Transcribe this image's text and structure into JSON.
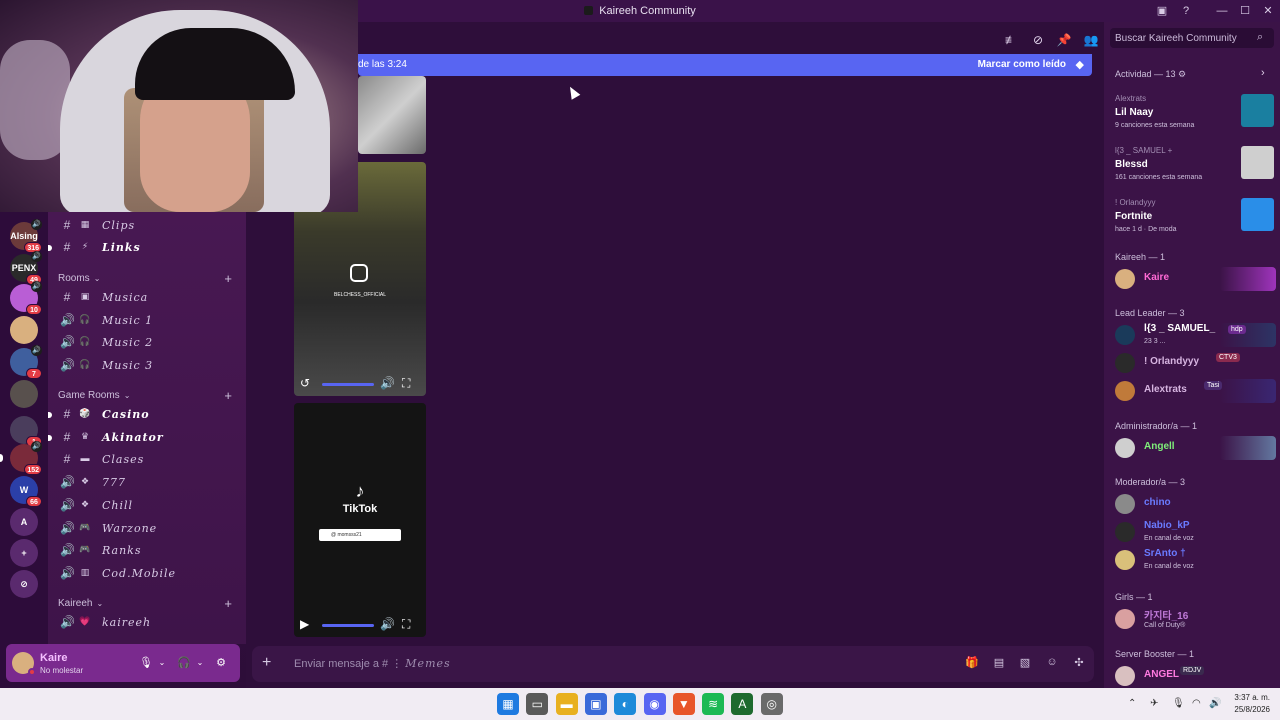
{
  "window": {
    "title": "Kaireeh Community"
  },
  "servers": [
    {
      "label": "Alsing",
      "badge": "316",
      "color": "#6b3a3a",
      "speaker": true
    },
    {
      "label": "PENX",
      "badge": "49",
      "color": "#2a2a2a",
      "speaker": true
    },
    {
      "label": "",
      "badge": "10",
      "color": "#b95ed5",
      "speaker": true
    },
    {
      "label": "",
      "badge": "",
      "color": "#d9b07f",
      "speaker": false
    },
    {
      "label": "",
      "badge": "7",
      "color": "#3f5f9e",
      "speaker": true
    },
    {
      "label": "",
      "badge": "",
      "color": "#58504d",
      "speaker": false
    },
    {
      "label": "",
      "badge": "1",
      "color": "#4a3d5c",
      "speaker": false
    },
    {
      "label": "",
      "badge": "152",
      "color": "#7a2a3a",
      "speaker": true
    },
    {
      "label": "W",
      "badge": "66",
      "color": "#2b3fa8",
      "speaker": false
    },
    {
      "label": "A",
      "badge": "",
      "color": "#5a2a6e",
      "speaker": false
    },
    {
      "label": "+",
      "badge": "",
      "color": "#5a2a6e",
      "speaker": false
    },
    {
      "label": "⊘",
      "badge": "",
      "color": "#5a2a6e",
      "speaker": false
    }
  ],
  "channels": {
    "top": [
      {
        "sym": "#",
        "icon": "▦",
        "name": "Clips",
        "bold": false,
        "unread": false
      },
      {
        "sym": "#",
        "icon": "⚡",
        "name": "Links",
        "bold": true,
        "unread": true
      }
    ],
    "rooms_label": "Rooms",
    "rooms": [
      {
        "sym": "#",
        "icon": "▣",
        "name": "Musica"
      },
      {
        "sym": "🔊",
        "icon": "🎧",
        "name": "Music 1"
      },
      {
        "sym": "🔊",
        "icon": "🎧",
        "name": "Music 2"
      },
      {
        "sym": "🔊",
        "icon": "🎧",
        "name": "Music 3"
      }
    ],
    "game_label": "Game Rooms",
    "game": [
      {
        "sym": "#",
        "icon": "🎲",
        "name": "Casino",
        "bold": true,
        "unread": true
      },
      {
        "sym": "#",
        "icon": "♛",
        "name": "Akinator",
        "bold": true,
        "unread": true
      },
      {
        "sym": "#",
        "icon": "▬",
        "name": "Clases",
        "bold": false,
        "unread": false
      },
      {
        "sym": "🔊",
        "icon": "❖",
        "name": "777",
        "bold": false,
        "unread": false
      },
      {
        "sym": "🔊",
        "icon": "❖",
        "name": "Chill",
        "bold": false,
        "unread": false
      },
      {
        "sym": "🔊",
        "icon": "🎮",
        "name": "Warzone",
        "bold": false,
        "unread": false
      },
      {
        "sym": "🔊",
        "icon": "🎮",
        "name": "Ranks",
        "bold": false,
        "unread": false
      },
      {
        "sym": "🔊",
        "icon": "▥",
        "name": "Cod.Mobile",
        "bold": false,
        "unread": false
      }
    ],
    "kaireeh_label": "Kaireeh",
    "kaireeh": [
      {
        "sym": "🔊",
        "icon": "💗",
        "name": "kaireeh"
      }
    ]
  },
  "user": {
    "name": "Kaire",
    "status": "No molestar"
  },
  "chat": {
    "new_messages": "de las 3:24",
    "mark_read": "Marcar como leído",
    "instagram_handle": "BELCHESS_OFFICIAL",
    "tiktok_label": "TikTok",
    "tiktok_handle": "@ momsss21",
    "composer_placeholder": "Enviar mensaje a #",
    "composer_channel": "Memes"
  },
  "members": {
    "search_placeholder": "Buscar Kaireeh Community",
    "activity_header": "Actividad — 13",
    "activity": [
      {
        "by": "Alextrats",
        "title": "Lil Naay",
        "detail": "9 canciones esta semana",
        "thumb": "#1a7fa0"
      },
      {
        "by": "l{3 _ SAMUEL +",
        "title": "Blessd",
        "detail": "161 canciones esta semana",
        "thumb": "#cfcfcf"
      },
      {
        "by": "! Orlandyyy",
        "title": "Fortnite",
        "detail": "hace 1 d   ·  De moda",
        "thumb": "#2a8ee8"
      }
    ],
    "groups": [
      {
        "label": "Kaireeh — 1",
        "members": [
          {
            "name": "Kaire",
            "color": "#ff6ad5",
            "sub": "",
            "tag": "",
            "tagcolor": "",
            "av": "#d9b07f",
            "banner": "#b03ad0"
          }
        ]
      },
      {
        "label": "Lead Leader — 3",
        "members": [
          {
            "name": "l{3 _ SAMUEL_",
            "color": "#ffffff",
            "sub": "23 3 ...",
            "tag": "hdp",
            "tagcolor": "#6b2a8e",
            "av": "#1a3a5a",
            "banner": "#2a3a6a"
          },
          {
            "name": "! Orlandyyy",
            "color": "#d6b4e0",
            "sub": "",
            "tag": "CTV3",
            "tagcolor": "#8a2a4e",
            "av": "#2a2a2a",
            "banner": ""
          },
          {
            "name": "Alextrats",
            "color": "#d6b4e0",
            "sub": "",
            "tag": "Tasi",
            "tagcolor": "#4a2a6e",
            "av": "#c07a3a",
            "banner": "#3a2a7a"
          }
        ]
      },
      {
        "label": "Administrador/a — 1",
        "members": [
          {
            "name": "Angell",
            "color": "#7ff07a",
            "sub": "",
            "tag": "",
            "tagcolor": "",
            "av": "#cfcfcf",
            "banner": "#6a8ab0"
          }
        ]
      },
      {
        "label": "Moderador/a — 3",
        "members": [
          {
            "name": "chino",
            "color": "#6a7bff",
            "sub": "",
            "tag": "",
            "tagcolor": "",
            "av": "#8a8a8a",
            "banner": ""
          },
          {
            "name": "Nabio_kP",
            "color": "#6a7bff",
            "sub": "En canal de voz",
            "tag": "",
            "tagcolor": "",
            "av": "#2a2a2a",
            "banner": ""
          },
          {
            "name": "SrAnto †",
            "color": "#6a7bff",
            "sub": "En canal de voz",
            "tag": "",
            "tagcolor": "",
            "av": "#d9c07a",
            "banner": ""
          }
        ]
      },
      {
        "label": "Girls — 1",
        "members": [
          {
            "name": "카지타_16",
            "color": "#c07ad9",
            "sub": "Call of Duty®",
            "tag": "",
            "tagcolor": "",
            "av": "#d9a0a0",
            "banner": ""
          }
        ]
      },
      {
        "label": "Server Booster — 1",
        "members": [
          {
            "name": "ANGEL",
            "color": "#ff7ae0",
            "sub": "",
            "tag": "RDJV",
            "tagcolor": "#3a2a4e",
            "av": "#d9c0c0",
            "banner": ""
          }
        ]
      }
    ]
  },
  "taskbar": {
    "apps": [
      {
        "name": "start",
        "color": "#1e7ae0",
        "glyph": "▦"
      },
      {
        "name": "taskview",
        "color": "#5a5a5a",
        "glyph": "▭"
      },
      {
        "name": "explorer",
        "color": "#e8b020",
        "glyph": "▬"
      },
      {
        "name": "store",
        "color": "#3a6ad9",
        "glyph": "▣"
      },
      {
        "name": "edge",
        "color": "#1e8ad9",
        "glyph": "◐"
      },
      {
        "name": "discord",
        "color": "#5865f2",
        "glyph": "◉"
      },
      {
        "name": "brave",
        "color": "#e8552a",
        "glyph": "▼"
      },
      {
        "name": "spotify",
        "color": "#1db954",
        "glyph": "≋"
      },
      {
        "name": "editor",
        "color": "#1e6a2e",
        "glyph": "A"
      },
      {
        "name": "recorder",
        "color": "#6a6a6a",
        "glyph": "◎"
      }
    ],
    "time": "3:37 a. m.",
    "date": "25/8/2026"
  }
}
